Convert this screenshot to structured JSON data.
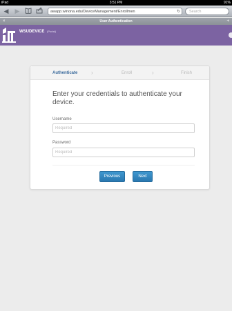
{
  "status_bar": {
    "device": "iPad",
    "time": "3:51 PM",
    "battery": "91%"
  },
  "browser": {
    "address": "awapp.winona.edu/DeviceManagement/Enrollmen",
    "search_placeholder": "Search",
    "tab_title": "User Authentication"
  },
  "app": {
    "name": "WSUDEVICE",
    "subtitle": "(Portal)",
    "accent_color": "#7c63a2"
  },
  "wizard": {
    "steps": [
      "Authenticate",
      "Enroll",
      "Finish"
    ],
    "active_step": "Authenticate"
  },
  "form": {
    "prompt": "Enter your credentials to authenticate your device.",
    "username_label": "Username",
    "username_placeholder": "Required",
    "username_value": "",
    "password_label": "Password",
    "password_placeholder": "Required",
    "password_value": ""
  },
  "buttons": {
    "previous": "Previous",
    "next": "Next",
    "color": "#2f86c2"
  }
}
